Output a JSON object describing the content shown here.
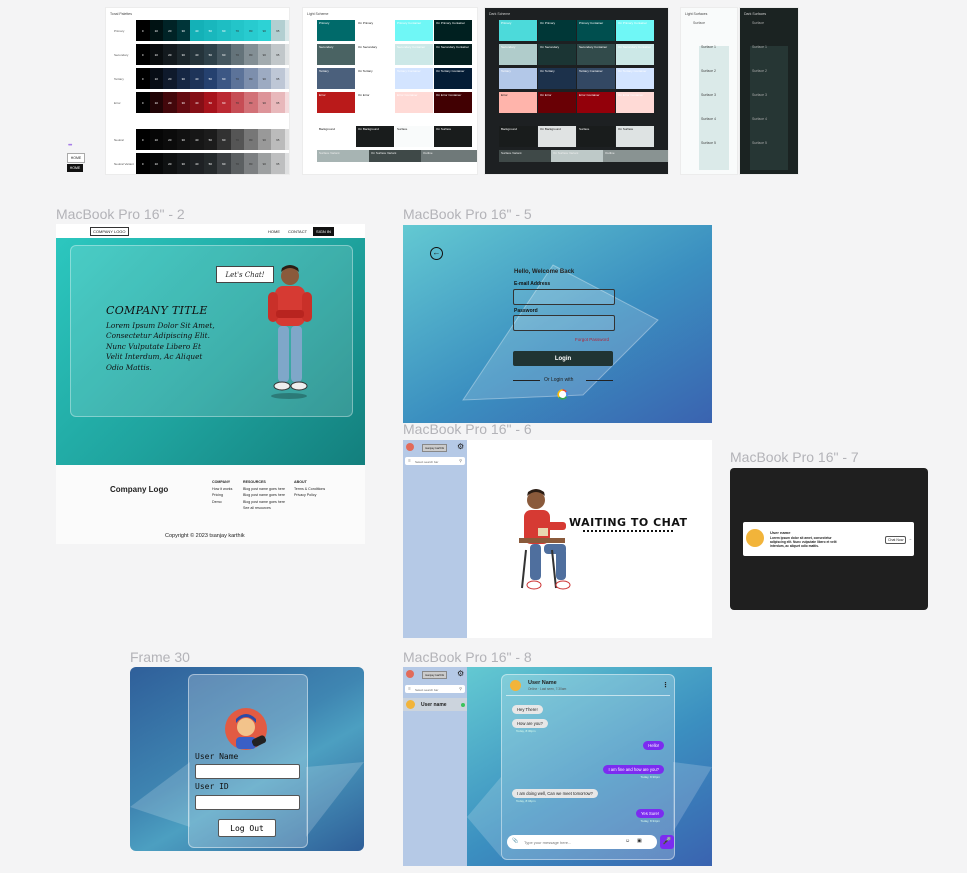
{
  "canvas_bg": "#f4f4f5",
  "palettes": {
    "tonal": {
      "title": "Tonal Palettes",
      "rows": [
        "Primary",
        "Secondary",
        "Tertiary",
        "Error",
        "Neutral",
        "Neutral Variant"
      ],
      "tones": [
        "0",
        "10",
        "20",
        "30",
        "40",
        "50",
        "60",
        "70",
        "80",
        "90",
        "95",
        "99",
        "100"
      ]
    },
    "light": {
      "title": "Light Scheme",
      "tiles": [
        [
          "Primary",
          "On Primary",
          "Primary Container",
          "On Primary Container"
        ],
        [
          "Secondary",
          "On Secondary",
          "Secondary Container",
          "On Secondary Container"
        ],
        [
          "Tertiary",
          "On Tertiary",
          "Tertiary Container",
          "On Tertiary Container"
        ],
        [
          "Error",
          "On Error",
          "Error Container",
          "On Error Container"
        ]
      ],
      "bottom": [
        "Background",
        "On Background",
        "Surface",
        "On Surface"
      ],
      "bottom2": [
        "Surface Variant",
        "On Surface Variant",
        "Outline"
      ]
    },
    "dark": {
      "title": "Dark Scheme",
      "tiles": [
        [
          "Primary",
          "On Primary",
          "Primary Container",
          "On Primary Container"
        ],
        [
          "Secondary",
          "On Secondary",
          "Secondary Container",
          "On Secondary Container"
        ],
        [
          "Tertiary",
          "On Tertiary",
          "Tertiary Container",
          "On Tertiary Container"
        ],
        [
          "Error",
          "On Error",
          "Error Container",
          "On Error Container"
        ]
      ],
      "bottom": [
        "Background",
        "On Background",
        "Surface",
        "On Surface"
      ],
      "bottom2": [
        "Surface Variant",
        "On Surface Variant",
        "Outline"
      ]
    },
    "light_surfaces": {
      "title": "Light Surfaces",
      "label": "Surface",
      "levels": [
        "Surface 1",
        "Surface 2",
        "Surface 3",
        "Surface 4",
        "Surface 5"
      ]
    },
    "dark_surfaces": {
      "title": "Dark Surfaces",
      "label": "Surface",
      "levels": [
        "Surface 1",
        "Surface 2",
        "Surface 3",
        "Surface 4",
        "Surface 5"
      ]
    },
    "chips": [
      "HOME",
      "HOME"
    ]
  },
  "frames": {
    "f2": {
      "label": "MacBook Pro 16\" - 2",
      "nav": {
        "logo": "COMPANY LOGO",
        "links": [
          "HOME",
          "CONTACT"
        ],
        "signin": "SIGN IN"
      },
      "hero": {
        "title": "COMPANY TITLE",
        "body": "Lorem Ipsum Dolor Sit Amet, Consectetur Adipiscing Elit. Nunc Vulputate Libero Et Velit Interdum, Ac Aliquet Odio Mattis.",
        "bubble": "Let's Chat!"
      },
      "footer": {
        "logo": "Company Logo",
        "cols": [
          {
            "head": "COMPANY",
            "items": [
              "How it works",
              "Pricing",
              "Demo"
            ]
          },
          {
            "head": "RESOURCES",
            "items": [
              "Blog post name goes here",
              "Blog post name goes here",
              "Blog post name goes here",
              "See all resources"
            ]
          },
          {
            "head": "ABOUT",
            "items": [
              "Terms & Conditions",
              "Privacy Policy"
            ]
          }
        ],
        "copyright": "Copyright © 2023 tsanjay karthik"
      }
    },
    "f5": {
      "label": "MacBook Pro 16\" - 5",
      "heading": "Hello, Welcome Back",
      "email_label": "E-mail Address",
      "password_label": "Password",
      "forgot": "Forgot Password",
      "login": "Login",
      "or": "Or Login with"
    },
    "f6": {
      "label": "MacBook Pro 16\" - 6",
      "user_chip": "tsanjay karthik",
      "search": "Select search bar",
      "waiting": "WAITING TO CHAT"
    },
    "f7": {
      "label": "MacBook Pro 16\" - 7",
      "name": "User name",
      "text": "Lorem ipsum dolor sit amet, consectetur adipiscing elit. Nunc vulputate libero et velit interdum, ac aliquet odio mattis.",
      "btn": "Chat Now"
    },
    "f30": {
      "label": "Frame 30",
      "username_label": "User Name",
      "userid_label": "User ID",
      "logout": "Log Out"
    },
    "f8": {
      "label": "MacBook Pro 16\" - 8",
      "user_chip": "tsanjay karthik",
      "search": "Select search bar",
      "contact": "User name",
      "header_name": "User Name",
      "header_status": "Online · Last seen, 7:30am",
      "messages": [
        {
          "dir": "in",
          "text": "Hey There!",
          "time": ""
        },
        {
          "dir": "in",
          "text": "How are you?",
          "time": "Today, 8:30pm"
        },
        {
          "dir": "out",
          "text": "Hello!",
          "time": ""
        },
        {
          "dir": "out",
          "text": "I am fine and how are you?",
          "time": "Today, 8:30pm"
        },
        {
          "dir": "in",
          "text": "I am doing well, Can we meet tomorrow?",
          "time": "Today, 8:34pm"
        },
        {
          "dir": "out",
          "text": "Yes Sure!",
          "time": "Today, 8:34pm"
        }
      ],
      "input_placeholder": "Type your message here..."
    }
  }
}
